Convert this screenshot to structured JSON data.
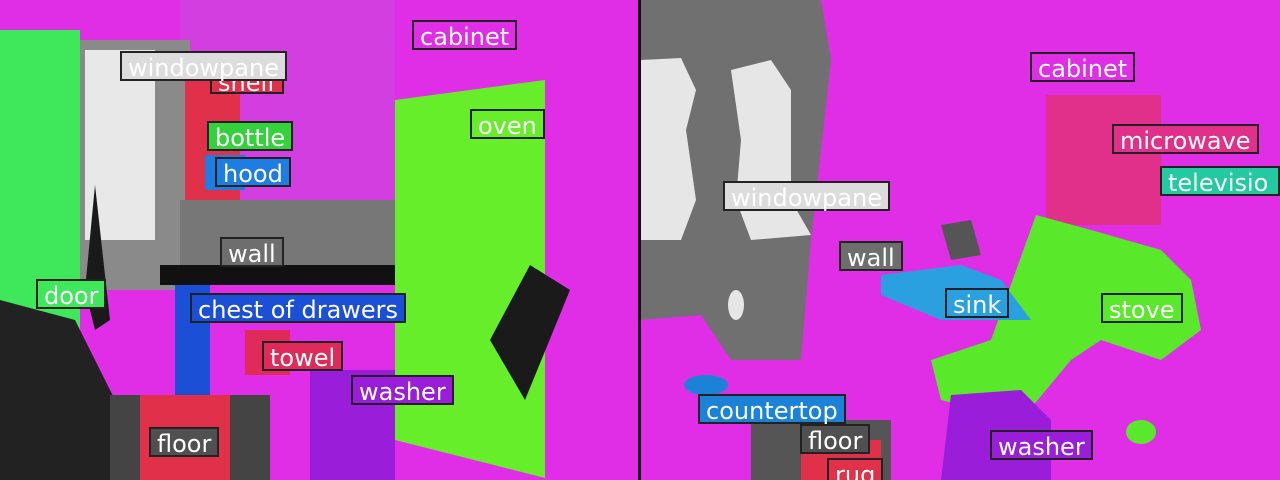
{
  "colors": {
    "cabinet": "#e02ee7",
    "wall": "#6e6e6e",
    "windowpane": "#d8d8d8",
    "oven": "#66ee2a",
    "door": "#3ee85a",
    "shelf": "#e0304a",
    "bottle": "#33d23a",
    "hood": "#1e7de0",
    "chest_of_drawers": "#1a4fd6",
    "towel": "#e02a5a",
    "washer": "#9a1ed9",
    "floor": "#505050",
    "rug": "#e02a5a",
    "countertop": "#1b82d8",
    "sink": "#2aa0e0",
    "stove": "#5ae82a",
    "microwave": "#e0308a",
    "television": "#23c9a0"
  },
  "left_panel": {
    "labels": {
      "cabinet": "cabinet",
      "windowpane": "windowpane",
      "shelf": "shelf",
      "oven": "oven",
      "bottle": "bottle",
      "hood": "hood",
      "wall": "wall",
      "door": "door",
      "chest_of_drawers": "chest of drawers",
      "towel": "towel",
      "washer": "washer",
      "floor": "floor"
    }
  },
  "right_panel": {
    "labels": {
      "cabinet": "cabinet",
      "microwave": "microwave",
      "television": "televisio",
      "windowpane": "windowpane",
      "wall": "wall",
      "sink": "sink",
      "stove": "stove",
      "countertop": "countertop",
      "floor": "floor",
      "washer": "washer",
      "rug": "rug"
    }
  }
}
